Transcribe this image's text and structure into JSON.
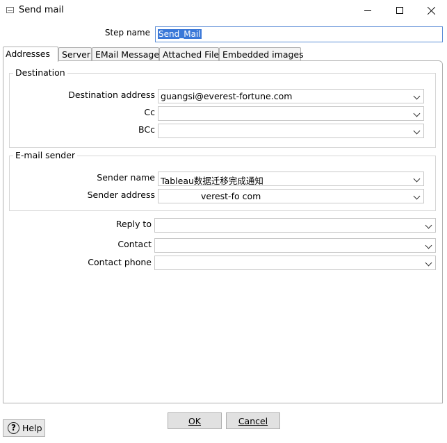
{
  "window": {
    "title": "Send mail"
  },
  "step": {
    "label": "Step name",
    "value": "Send_Mail"
  },
  "tabs": [
    {
      "label": "Addresses"
    },
    {
      "label": "Server"
    },
    {
      "label": "EMail Message"
    },
    {
      "label": "Attached Files"
    },
    {
      "label": "Embedded images"
    }
  ],
  "destination": {
    "title": "Destination",
    "fields": [
      {
        "label": "Destination address",
        "value": "guangsi@everest-fortune.com"
      },
      {
        "label": "Cc",
        "value": ""
      },
      {
        "label": "BCc",
        "value": ""
      }
    ]
  },
  "sender": {
    "title": "E-mail sender",
    "fields": [
      {
        "label": "Sender name",
        "value": "Tableau数据迁移完成通知"
      },
      {
        "label": "Sender address",
        "value": "verest-fo com"
      }
    ]
  },
  "extra": {
    "fields": [
      {
        "label": "Reply to",
        "value": ""
      },
      {
        "label": "Contact",
        "value": ""
      },
      {
        "label": "Contact phone",
        "value": ""
      }
    ]
  },
  "buttons": {
    "ok_label": "OK",
    "cancel_label": "Cancel",
    "help_label": "Help"
  },
  "colors": {
    "selection": "#3a78d8",
    "focus_border": "#5c8dd6",
    "button_bg": "#e1e1e1"
  }
}
